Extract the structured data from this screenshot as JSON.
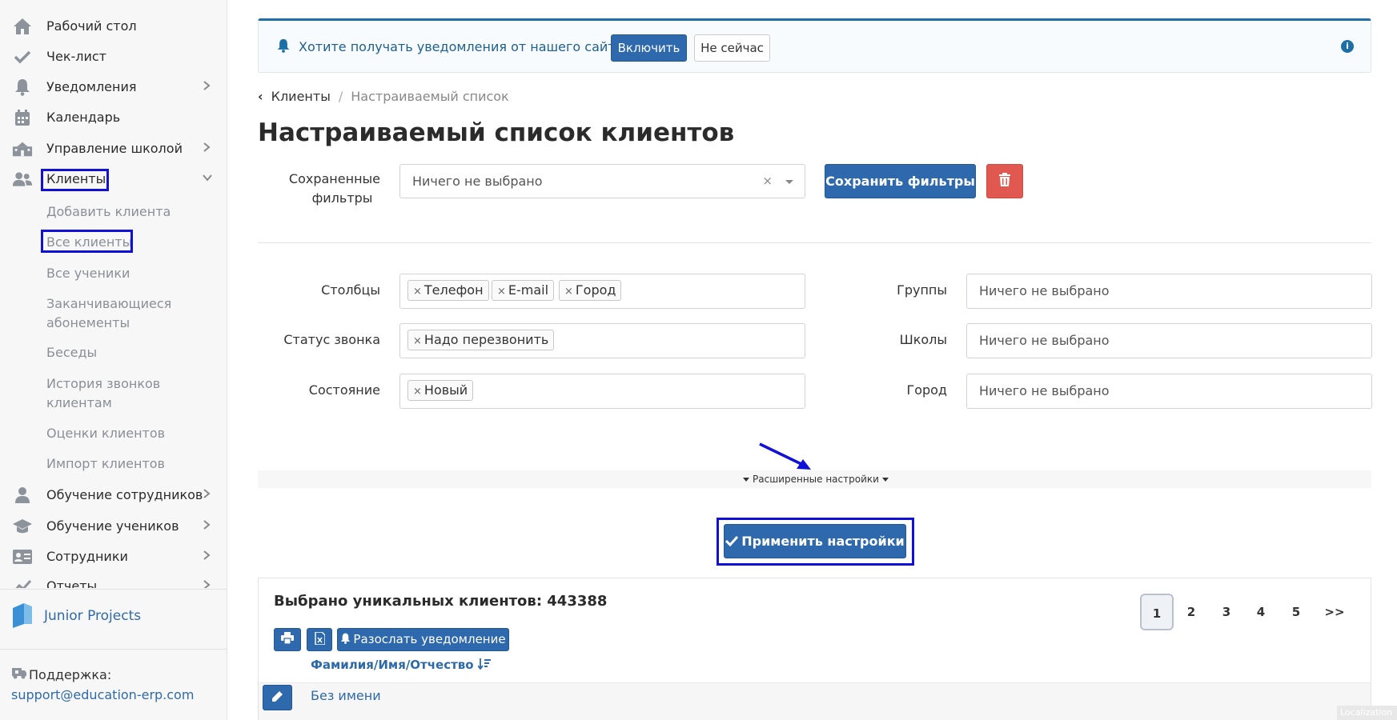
{
  "sidebar": {
    "items": [
      {
        "label": "Рабочий стол",
        "icon": "home-icon"
      },
      {
        "label": "Чек-лист",
        "icon": "check-icon"
      },
      {
        "label": "Уведомления",
        "icon": "bell-icon"
      },
      {
        "label": "Календарь",
        "icon": "calendar-icon"
      },
      {
        "label": "Управление школой",
        "icon": "school-icon"
      },
      {
        "label": "Клиенты",
        "icon": "users-icon"
      },
      {
        "label": "Обучение сотрудников",
        "icon": "user-icon"
      },
      {
        "label": "Обучение учеников",
        "icon": "graduation-cap-icon"
      },
      {
        "label": "Сотрудники",
        "icon": "id-card-icon"
      },
      {
        "label": "Отчеты",
        "icon": "chart-icon"
      }
    ],
    "sub_items": [
      "Добавить клиента",
      "Все клиенты",
      "Все ученики",
      "Заканчивающиеся абонементы",
      "Беседы",
      "История звонков клиентам",
      "Оценки клиентов",
      "Импорт клиентов"
    ],
    "brand": "Junior Projects",
    "support_label": "Поддержка:",
    "support_email": "support@education-erp.com"
  },
  "notification": {
    "message": "Хотите получать уведомления от нашего сайта?",
    "enable_label": "Включить",
    "not_now_label": "Не сейчас",
    "info_glyph": "i"
  },
  "breadcrumb": {
    "back_glyph": "‹",
    "parent": "Клиенты",
    "separator": "/",
    "current": "Настраиваемый список"
  },
  "page_title": "Настраиваемый список клиентов",
  "saved_filters": {
    "label_line1": "Сохраненные",
    "label_line2": "фильтры",
    "value": "Ничего не выбрано",
    "clear": "×",
    "save_label": "Сохранить фильтры"
  },
  "filters": {
    "columns": {
      "label": "Столбцы",
      "tags": [
        "Телефон",
        "E-mail",
        "Город"
      ]
    },
    "call_status": {
      "label": "Статус звонка",
      "tags": [
        "Надо перезвонить"
      ]
    },
    "state": {
      "label": "Состояние",
      "tags": [
        "Новый"
      ]
    },
    "groups": {
      "label": "Группы",
      "placeholder": "Ничего не выбрано"
    },
    "schools": {
      "label": "Школы",
      "placeholder": "Ничего не выбрано"
    },
    "city": {
      "label": "Город",
      "placeholder": "Ничего не выбрано"
    },
    "tag_remove": "×"
  },
  "advanced": {
    "label": "Расширенные настройки"
  },
  "apply": {
    "label": "Применить настройки"
  },
  "results": {
    "count_text": "Выбрано уникальных клиентов: 443388",
    "pages": [
      "1",
      "2",
      "3",
      "4",
      "5",
      ">>"
    ],
    "active_page": "1",
    "send_label": "Разослать уведомление",
    "column_header": "Фамилия/Имя/Отчество",
    "rows": [
      {
        "name": "Без имени"
      }
    ]
  },
  "watermark": "Localization",
  "colors": {
    "primary": "#2e69ae",
    "danger": "#e0584f",
    "highlight": "#1010d8",
    "link": "#2f6aa8"
  }
}
